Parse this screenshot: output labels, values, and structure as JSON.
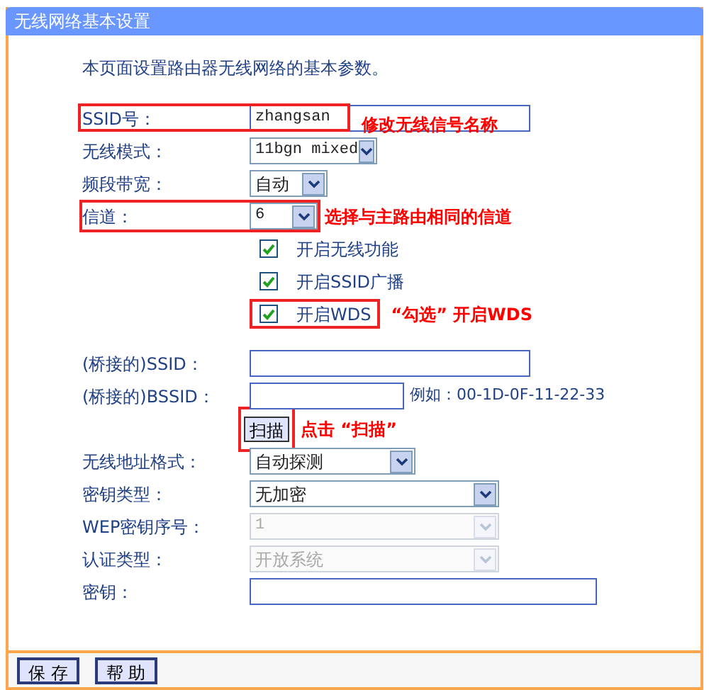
{
  "window": {
    "title": "无线网络基本设置"
  },
  "intro": "本页面设置路由器无线网络的基本参数。",
  "rows": [
    {
      "kind": "text",
      "label": "SSID号：",
      "value": "zhangsan",
      "highlighted": true,
      "note": "修改无线信号名称"
    },
    {
      "kind": "select",
      "label": "无线模式：",
      "value": "11bgn mixed",
      "highlighted": false,
      "disabled": false
    },
    {
      "kind": "select",
      "label": "频段带宽：",
      "value": "自动",
      "highlighted": false,
      "disabled": false
    },
    {
      "kind": "select",
      "label": "信道：",
      "value": "6",
      "highlighted": true,
      "disabled": false,
      "note": "选择与主路由相同的信道"
    },
    {
      "kind": "checkbox",
      "label": "开启无线功能",
      "checked": true,
      "highlighted": false
    },
    {
      "kind": "checkbox",
      "label": "开启SSID广播",
      "checked": true,
      "highlighted": false
    },
    {
      "kind": "checkbox",
      "label": "开启WDS",
      "checked": true,
      "highlighted": true,
      "note": "“勾选” 开启WDS"
    },
    {
      "kind": "gap"
    },
    {
      "kind": "text",
      "label": "(桥接的)SSID：",
      "highlighted": false
    },
    {
      "kind": "text",
      "label": "(桥接的)BSSID：",
      "highlighted": false,
      "hint": "例如：00-1D-0F-11-22-33"
    },
    {
      "kind": "button",
      "label": "扫描",
      "highlighted": true,
      "note": "点击 “扫描”"
    },
    {
      "kind": "select",
      "label": "无线地址格式：",
      "value": "自动探测",
      "highlighted": false,
      "disabled": false
    },
    {
      "kind": "select",
      "label": "密钥类型：",
      "value": "无加密",
      "highlighted": false,
      "disabled": false
    },
    {
      "kind": "select",
      "label": "WEP密钥序号：",
      "value": "1",
      "highlighted": false,
      "disabled": true
    },
    {
      "kind": "select",
      "label": "认证类型：",
      "value": "开放系统",
      "highlighted": false,
      "disabled": true
    },
    {
      "kind": "text",
      "label": "密钥：",
      "highlighted": false
    }
  ],
  "buttons": [
    "保 存",
    "帮 助"
  ]
}
